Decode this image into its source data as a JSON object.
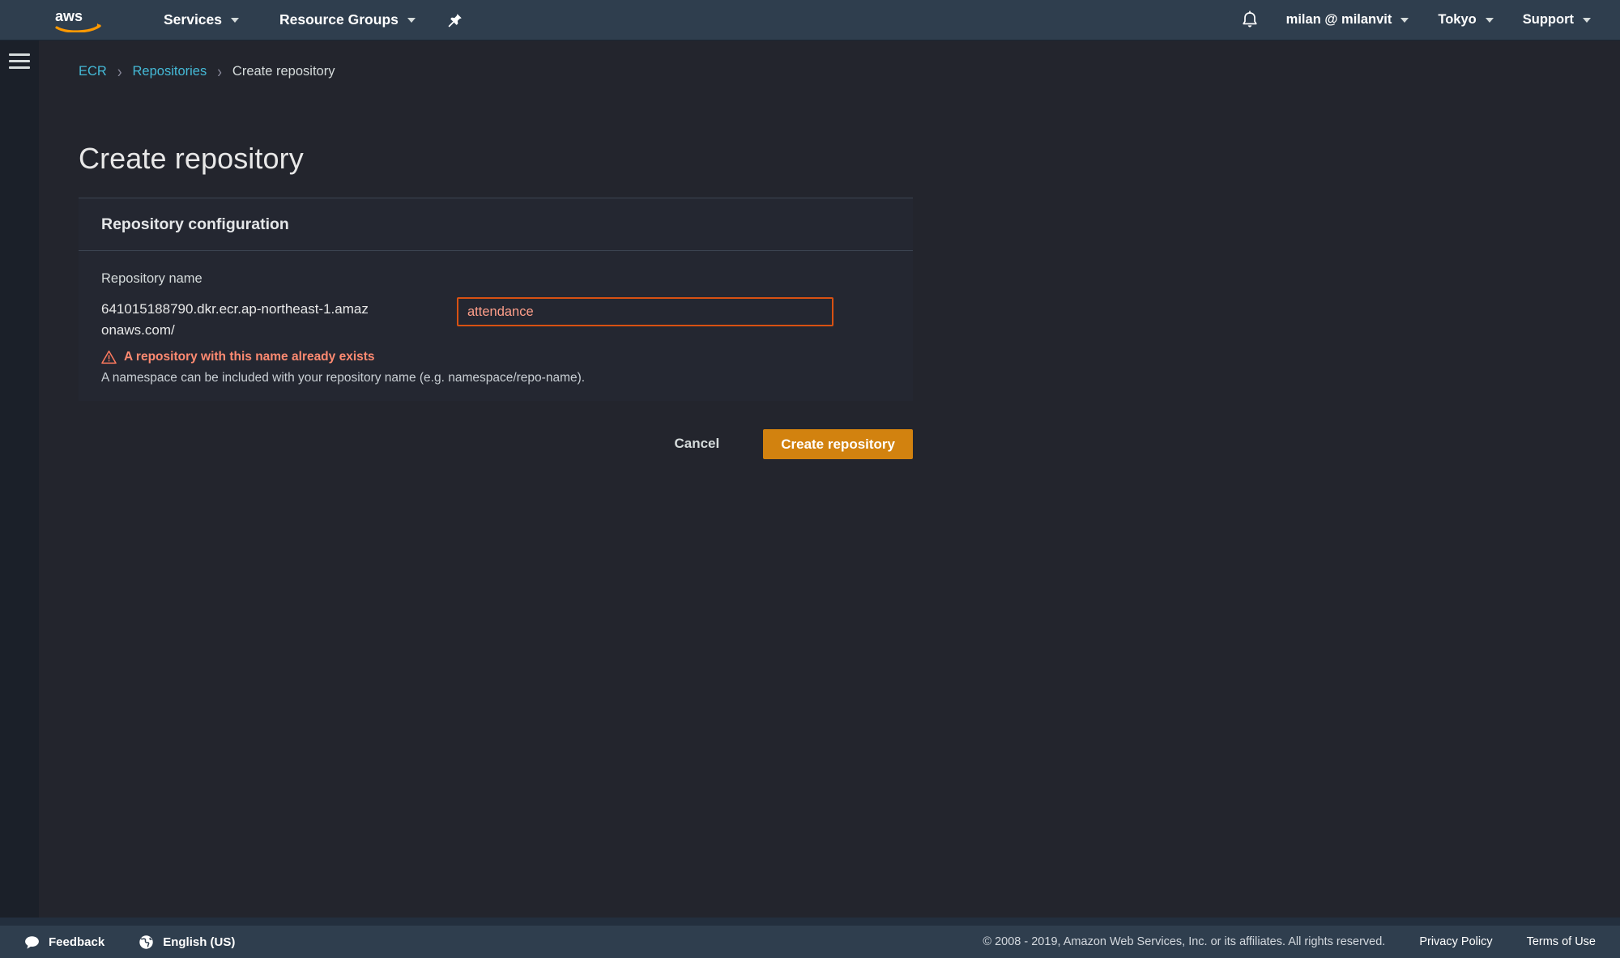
{
  "topnav": {
    "logo_alt": "aws",
    "services_label": "Services",
    "resource_groups_label": "Resource Groups",
    "pin_icon": "pushpin-icon",
    "bell_icon": "notifications-bell-icon",
    "account_label": "milan @ milanvit",
    "region_label": "Tokyo",
    "support_label": "Support"
  },
  "sidebar": {
    "menu_icon": "hamburger-menu-icon"
  },
  "breadcrumb": {
    "items": [
      {
        "label": "ECR",
        "link": true
      },
      {
        "label": "Repositories",
        "link": true
      },
      {
        "label": "Create repository",
        "link": false
      }
    ],
    "separator": "›"
  },
  "page": {
    "title": "Create repository"
  },
  "card": {
    "header_title": "Repository configuration",
    "field_label": "Repository name",
    "registry_prefix": "641015188790.dkr.ecr.ap-northeast-1.amazonaws.com/",
    "input_value": "attendance",
    "input_placeholder": "",
    "error_icon": "warning-triangle-icon",
    "error_message": "A repository with this name already exists",
    "helper_text": "A namespace can be included with your repository name (e.g. namespace/repo-name)."
  },
  "actions": {
    "cancel_label": "Cancel",
    "create_label": "Create repository"
  },
  "footer": {
    "feedback_label": "Feedback",
    "feedback_icon": "speech-bubble-icon",
    "language_label": "English (US)",
    "language_icon": "globe-icon",
    "copyright": "© 2008 - 2019, Amazon Web Services, Inc. or its affiliates. All rights reserved.",
    "privacy_label": "Privacy Policy",
    "terms_label": "Terms of Use"
  },
  "colors": {
    "nav_bg": "#2f3e4e",
    "page_bg": "#23252d",
    "card_bg": "#242731",
    "link": "#44b9d6",
    "error": "#ff8a71",
    "error_border": "#d85112",
    "primary_button": "#d2820f"
  }
}
